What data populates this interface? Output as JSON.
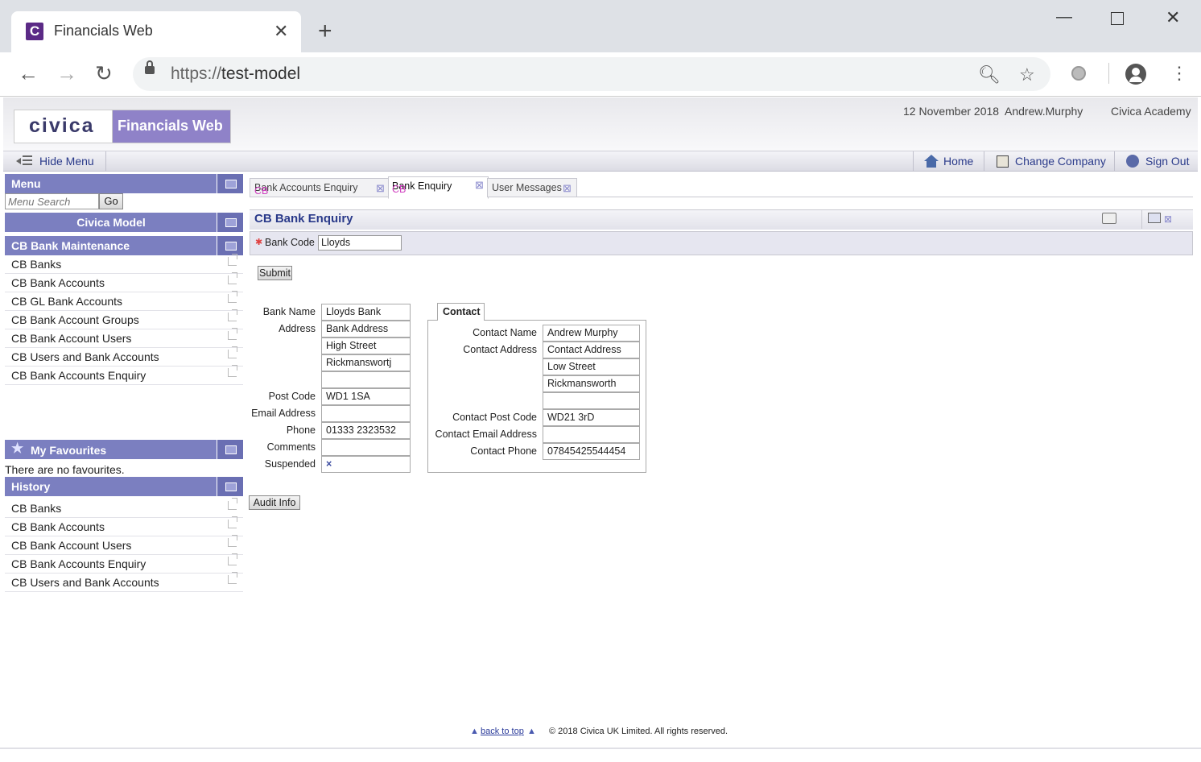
{
  "browser": {
    "tab_title": "Financials Web",
    "favicon_letter": "C",
    "url_scheme": "https://",
    "url_host": "test-model"
  },
  "header": {
    "logo_left": "civica",
    "logo_right": "Financials Web",
    "date": "12 November 2018",
    "user": "Andrew.Murphy",
    "company": "Civica Academy"
  },
  "menubar": {
    "hide_menu": "Hide Menu",
    "home": "Home",
    "change_company": "Change Company",
    "sign_out": "Sign Out"
  },
  "sidebar": {
    "menu_title": "Menu",
    "search_placeholder": "Menu Search",
    "go_label": "Go",
    "org_title": "Civica Model",
    "section_title": "CB Bank Maintenance",
    "items": [
      "CB Banks",
      "CB Bank Accounts",
      "CB GL Bank Accounts",
      "CB Bank Account Groups",
      "CB Bank Account Users",
      "CB Users and Bank Accounts",
      "CB Bank Accounts Enquiry"
    ],
    "favourites_title": "My Favourites",
    "favourites_empty": "There are no favourites.",
    "history_title": "History",
    "history": [
      "CB Banks",
      "CB Bank Accounts",
      "CB Bank Account Users",
      "CB Bank Accounts Enquiry",
      "CB Users and Bank Accounts"
    ]
  },
  "tabs": [
    {
      "prefix": "CB",
      "label": "Bank Accounts Enquiry"
    },
    {
      "prefix": "CB",
      "label": "Bank Enquiry"
    },
    {
      "prefix": "",
      "label": "User Messages"
    }
  ],
  "form": {
    "title": "CB Bank Enquiry",
    "bank_code_label": "Bank Code",
    "bank_code_value": "Lloyds",
    "submit_label": "Submit",
    "audit_label": "Audit Info",
    "left_labels": {
      "bank_name": "Bank Name",
      "address": "Address",
      "post_code": "Post Code",
      "email": "Email Address",
      "phone": "Phone",
      "comments": "Comments",
      "suspended": "Suspended"
    },
    "bank_name": "Lloyds Bank",
    "address": [
      "Bank Address",
      "High Street",
      "Rickmanswortj",
      ""
    ],
    "post_code": "WD1 1SA",
    "email": "",
    "phone": "01333 2323532",
    "comments": "",
    "suspended": "×",
    "contact_tab": "Contact",
    "contact_labels": {
      "name": "Contact Name",
      "address": "Contact Address",
      "post_code": "Contact Post Code",
      "email": "Contact Email Address",
      "phone": "Contact Phone"
    },
    "contact_name": "Andrew Murphy",
    "contact_address": [
      "Contact Address",
      "Low Street",
      "Rickmansworth",
      ""
    ],
    "contact_post_code": "WD21 3rD",
    "contact_email": "",
    "contact_phone": "07845425544454"
  },
  "footer": {
    "back_to_top": "back to top",
    "copyright": "© 2018 Civica UK Limited. All rights reserved."
  }
}
